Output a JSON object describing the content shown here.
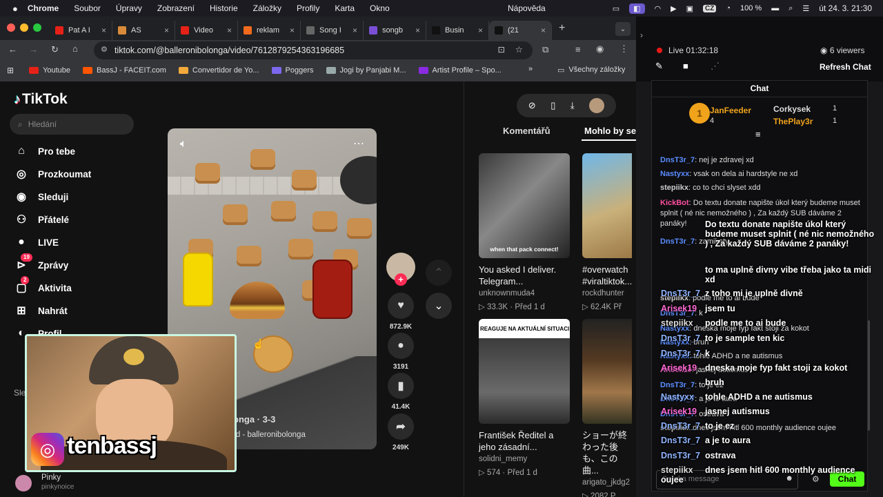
{
  "menubar": {
    "app": "Chrome",
    "items": [
      "Soubor",
      "Úpravy",
      "Zobrazení",
      "Historie",
      "Záložky",
      "Profily",
      "Karta",
      "Okno"
    ],
    "help": "Nápověda",
    "battery": "100 %",
    "keyboard": "CZ",
    "datetime": "út 24. 3.  21:30"
  },
  "tabs": [
    {
      "label": "Pat A I",
      "color": "#e62117"
    },
    {
      "label": "AS",
      "color": "#d98b3a"
    },
    {
      "label": "Video",
      "color": "#e62117"
    },
    {
      "label": "reklam",
      "color": "#f26b1d"
    },
    {
      "label": "Song I",
      "color": "#666"
    },
    {
      "label": "songb",
      "color": "#7a4fd6"
    },
    {
      "label": "Busin",
      "color": "#111"
    },
    {
      "label": "(21",
      "color": "#111"
    }
  ],
  "address": {
    "url": "tiktok.com/@balleronibolonga/video/7612879254363196685"
  },
  "bookmarks": [
    {
      "label": "Youtube",
      "color": "#e62117"
    },
    {
      "label": "BassJ - FACEIT.com",
      "color": "#ff5500"
    },
    {
      "label": "Convertidor de Yo...",
      "color": "#f2a93b"
    },
    {
      "label": "Poggers",
      "color": "#7b68ee"
    },
    {
      "label": "Jogi by Panjabi M...",
      "color": "#9aa"
    },
    {
      "label": "Artist Profile – Spo...",
      "color": "#8a2be2"
    }
  ],
  "bookmarks_more": "Všechny záložky",
  "tiktok": {
    "logo": "TikTok",
    "search_placeholder": "Hledání",
    "nav": [
      {
        "label": "Pro tebe",
        "icon": "home-icon",
        "glyph": "⌂"
      },
      {
        "label": "Prozkoumat",
        "icon": "compass-icon",
        "glyph": "◎"
      },
      {
        "label": "Sleduji",
        "icon": "following-icon",
        "glyph": "◉"
      },
      {
        "label": "Přátelé",
        "icon": "friends-icon",
        "glyph": "⚇"
      },
      {
        "label": "LIVE",
        "icon": "live-icon",
        "glyph": "●"
      },
      {
        "label": "Zprávy",
        "icon": "messages-icon",
        "glyph": "⊳",
        "badge": "19"
      },
      {
        "label": "Aktivita",
        "icon": "activity-icon",
        "glyph": "▢",
        "badge": "2"
      },
      {
        "label": "Nahrát",
        "icon": "upload-icon",
        "glyph": "⊞"
      }
    ],
    "nav_extra": "Profil",
    "following_label": "Sle",
    "following_user": {
      "name": "Pinky",
      "handle": "pinkynoice"
    },
    "video": {
      "caption_user": "onga · 3-3",
      "music": "rd - balleronibolonga"
    },
    "actions": {
      "likes": "872.9K",
      "comments": "3191",
      "saves": "41.4K",
      "shares": "249K"
    },
    "tabs": [
      "Komentářů",
      "Mohlo by se"
    ],
    "cards": [
      {
        "title": "You asked I deliver. Telegram...",
        "user": "unknownmuda4",
        "views": "33.3K",
        "time": "Před 1 d",
        "overlay": "when that pack connect!"
      },
      {
        "title": "#overwatch #viraltiktok...",
        "user": "rockdhunter",
        "views": "62.4K",
        "time": "Př"
      },
      {
        "title": "František Ředitel a jeho zásadní...",
        "user": "solidni_memy",
        "views": "574",
        "time": "Před 1 d",
        "overlay": "REAGUJE NA AKTUÁLNÍ SITUACI N"
      },
      {
        "title": "ショーが終わった後も、この曲...",
        "user": "arigato_jkdg2",
        "views": "2082",
        "time": "P"
      }
    ]
  },
  "stream": {
    "live_label": "Live",
    "uptime": "01:32:18",
    "viewers": "6 viewers",
    "refresh": "Refresh Chat",
    "chat_tab": "Chat",
    "leaders": [
      {
        "name": "JanFeeder",
        "count": "4",
        "color": "#f0a31b"
      },
      {
        "name": "Corkysek",
        "count": "1",
        "color": "#ddd"
      },
      {
        "name": "ThePlay3r",
        "count": "1",
        "color": "#f0a31b"
      }
    ],
    "messages": [
      {
        "user": "DnsT3r_7",
        "text": "nej je zdravej xd",
        "color": "#5a8cff"
      },
      {
        "user": "Nastyxx",
        "text": "vsak on dela ai hardstyle ne xd",
        "color": "#5a8cff"
      },
      {
        "user": "stepiikx",
        "text": "co to chci slyset xdd",
        "color": "#ccc"
      },
      {
        "user": "KickBot",
        "text": "Do textu donate napište úkol který budeme muset splnit ( né nic nemožného ) , Za každý SUB dáváme 2 panáky!",
        "color": "#ff4fa0"
      },
      {
        "user": "DnsT3r_7",
        "text": "zamikaty",
        "color": "#5a8cff"
      },
      {
        "user": "stepiikx",
        "text": "podle me to ai bude",
        "color": "#ccc"
      },
      {
        "user": "DnsT3r_7",
        "text": "k",
        "color": "#5a8cff"
      },
      {
        "user": "Nastyxx",
        "text": "dneska moje fyp fakt stoji za kokot",
        "color": "#5a8cff"
      },
      {
        "user": "Nastyxx",
        "text": "bruh",
        "color": "#5a8cff"
      },
      {
        "user": "Nastyxx",
        "text": "tohle ADHD a ne autismus",
        "color": "#5a8cff"
      },
      {
        "user": "Arisek19",
        "text": "jasnej autismus",
        "color": "#ff6ad5"
      },
      {
        "user": "DnsT3r_7",
        "text": "to je ez",
        "color": "#5a8cff"
      },
      {
        "user": "DnsT3r_7",
        "text": "a je to aura",
        "color": "#5a8cff"
      },
      {
        "user": "DnsT3r_7",
        "text": "ostrava",
        "color": "#5a8cff"
      },
      {
        "user": "stepiikx",
        "text": "dnes jsem hitl 600 monthly audience oujee",
        "color": "#ccc"
      }
    ],
    "overlay_messages": [
      {
        "user": "",
        "text": "Do textu donate napište úkol který budeme muset splnit ( né nic nemožného ) , Za každý SUB dáváme 2 panáky!",
        "color": "#fff"
      },
      {
        "user": "",
        "text": "to ma uplně divny vibe třeba jako ta midi xd",
        "color": "#fff"
      },
      {
        "user": "DnsT3r_7",
        "text": "z toho mi je uplně divně",
        "color": "#8fb4ff"
      },
      {
        "user": "Arisek19",
        "text": "jsem tu",
        "color": "#ff6ad5"
      },
      {
        "user": "stepiikx",
        "text": "podle me to ai bude",
        "color": "#ddd"
      },
      {
        "user": "DnsT3r_7",
        "text": "to je sample ten kic",
        "color": "#8fb4ff"
      },
      {
        "user": "DnsT3r_7",
        "text": "k",
        "color": "#8fb4ff"
      },
      {
        "user": "Arisek19",
        "text": "dneska moje fyp fakt stoji za kokot",
        "color": "#ff6ad5"
      },
      {
        "user": "",
        "text": "bruh",
        "color": "#fff"
      },
      {
        "user": "Nastyxx",
        "text": "tohle ADHD a ne autismus",
        "color": "#8fb4ff"
      },
      {
        "user": "Arisek19",
        "text": "jasnej autismus",
        "color": "#ff6ad5"
      },
      {
        "user": "DnsT3r_7",
        "text": "to je ez",
        "color": "#8fb4ff"
      },
      {
        "user": "DnsT3r_7",
        "text": "a je to aura",
        "color": "#8fb4ff"
      },
      {
        "user": "DnsT3r_7",
        "text": "ostrava",
        "color": "#8fb4ff"
      },
      {
        "user": "stepiikx",
        "text": "dnes jsem hitl 600 monthly audience oujee",
        "color": "#ddd"
      }
    ],
    "input_placeholder": "Send a message",
    "send": "Chat"
  },
  "webcam": {
    "handle": "tenbassj"
  }
}
